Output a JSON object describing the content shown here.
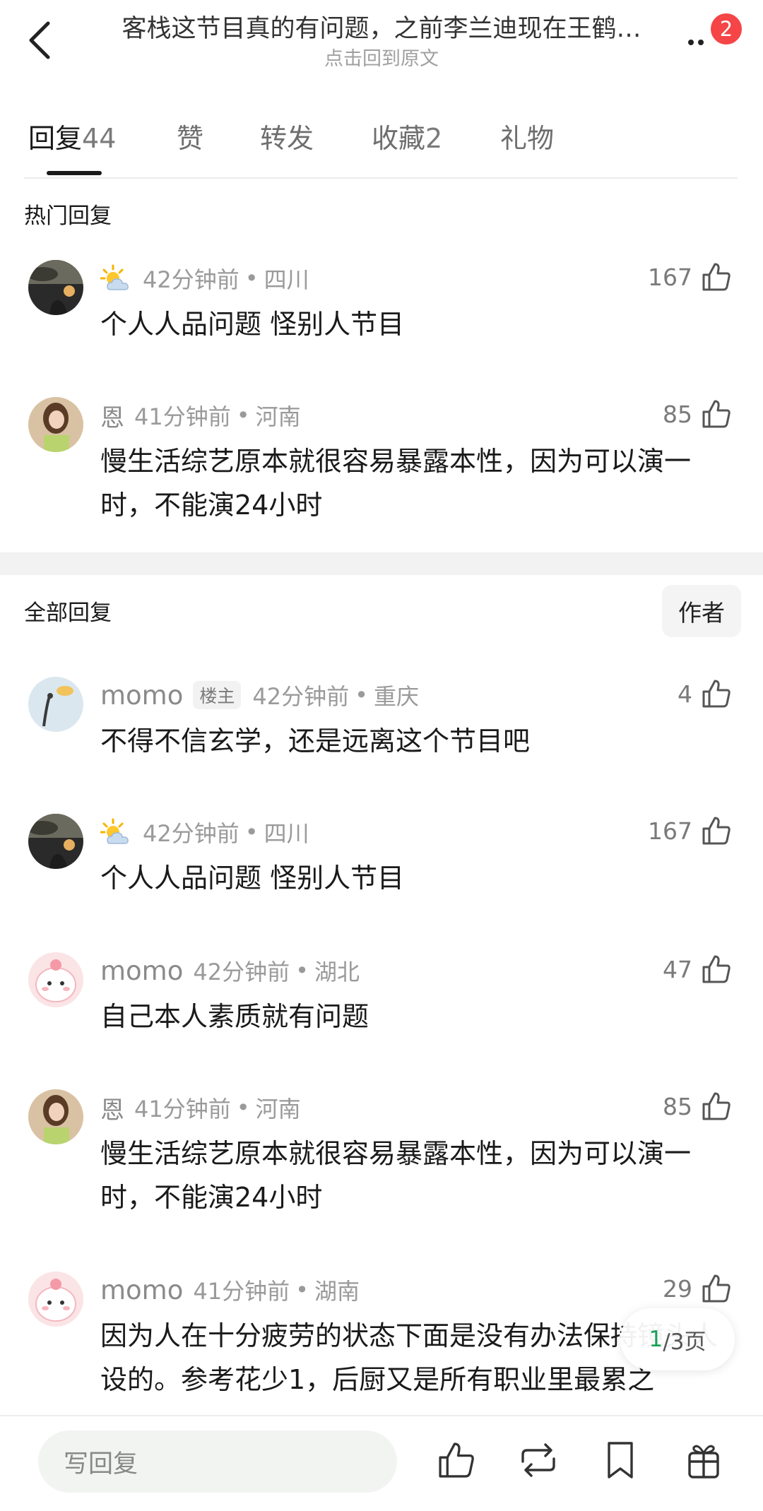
{
  "header": {
    "title": "客栈这节目真的有问题，之前李兰迪现在王鹤…",
    "subtitle": "点击回到原文",
    "badge_count": "2"
  },
  "tabs": [
    {
      "label": "回复",
      "count": "44"
    },
    {
      "label": "赞",
      "count": ""
    },
    {
      "label": "转发",
      "count": ""
    },
    {
      "label": "收藏",
      "count": "2"
    },
    {
      "label": "礼物",
      "count": ""
    }
  ],
  "hot_section": {
    "title": "热门回复",
    "comments": [
      {
        "username": "",
        "user_icon": "sun-behind-cloud-icon",
        "time": "42分钟前",
        "location": "四川",
        "likes": "167",
        "text": "个人人品问题 怪别人节目"
      },
      {
        "username": "恩",
        "time": "41分钟前",
        "location": "河南",
        "likes": "85",
        "text": "慢生活综艺原本就很容易暴露本性，因为可以演一时，不能演24小时"
      }
    ]
  },
  "all_section": {
    "title": "全部回复",
    "author_filter": "作者",
    "comments": [
      {
        "username": "momo",
        "tag": "楼主",
        "time": "42分钟前",
        "location": "重庆",
        "likes": "4",
        "text": "不得不信玄学，还是远离这个节目吧"
      },
      {
        "username": "",
        "user_icon": "sun-behind-cloud-icon",
        "time": "42分钟前",
        "location": "四川",
        "likes": "167",
        "text": "个人人品问题 怪别人节目"
      },
      {
        "username": "momo",
        "time": "42分钟前",
        "location": "湖北",
        "likes": "47",
        "text": "自己本人素质就有问题"
      },
      {
        "username": "恩",
        "time": "41分钟前",
        "location": "河南",
        "likes": "85",
        "text": "慢生活综艺原本就很容易暴露本性，因为可以演一时，不能演24小时"
      },
      {
        "username": "momo",
        "time": "41分钟前",
        "location": "湖南",
        "likes": "29",
        "text": "因为人在十分疲劳的状态下面是没有办法保持镜头人设的。参考花少1，后厨又是所有职业里最累之"
      }
    ]
  },
  "pager": {
    "current": "1",
    "rest": "/3页"
  },
  "bottom_bar": {
    "reply_placeholder": "写回复"
  },
  "colors": {
    "badge": "#f54546",
    "pager_current": "#18a058"
  }
}
